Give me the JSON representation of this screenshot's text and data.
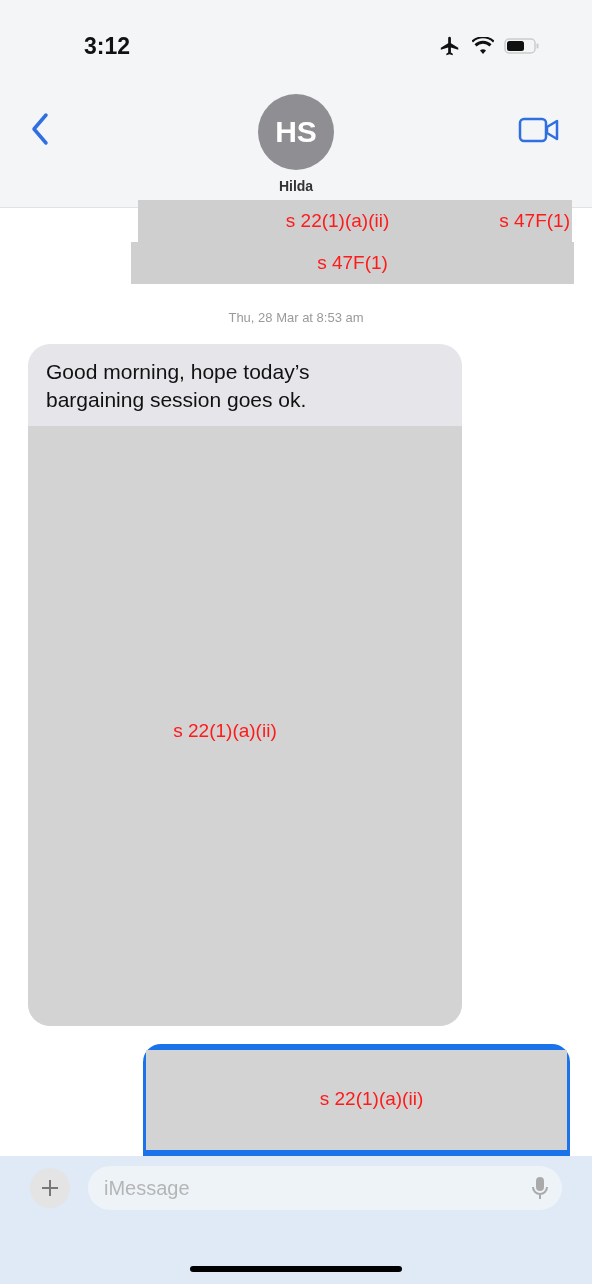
{
  "status_bar": {
    "time": "3:12"
  },
  "header": {
    "avatar_initials": "HS",
    "contact_name": "Hilda"
  },
  "top_redactions": [
    {
      "labels": [
        "s 22(1)(a)(ii)",
        "s 47F(1)"
      ]
    },
    {
      "labels": [
        "s 47F(1)"
      ]
    }
  ],
  "timestamp": "Thu, 28 Mar at 8:53 am",
  "messages": [
    {
      "kind": "received",
      "text": "Good morning, hope today’s bargaining session goes ok.",
      "redaction": "s 22(1)(a)(ii)"
    },
    {
      "kind": "sent",
      "redaction": "s 22(1)(a)(ii)"
    }
  ],
  "input": {
    "placeholder": "iMessage"
  }
}
